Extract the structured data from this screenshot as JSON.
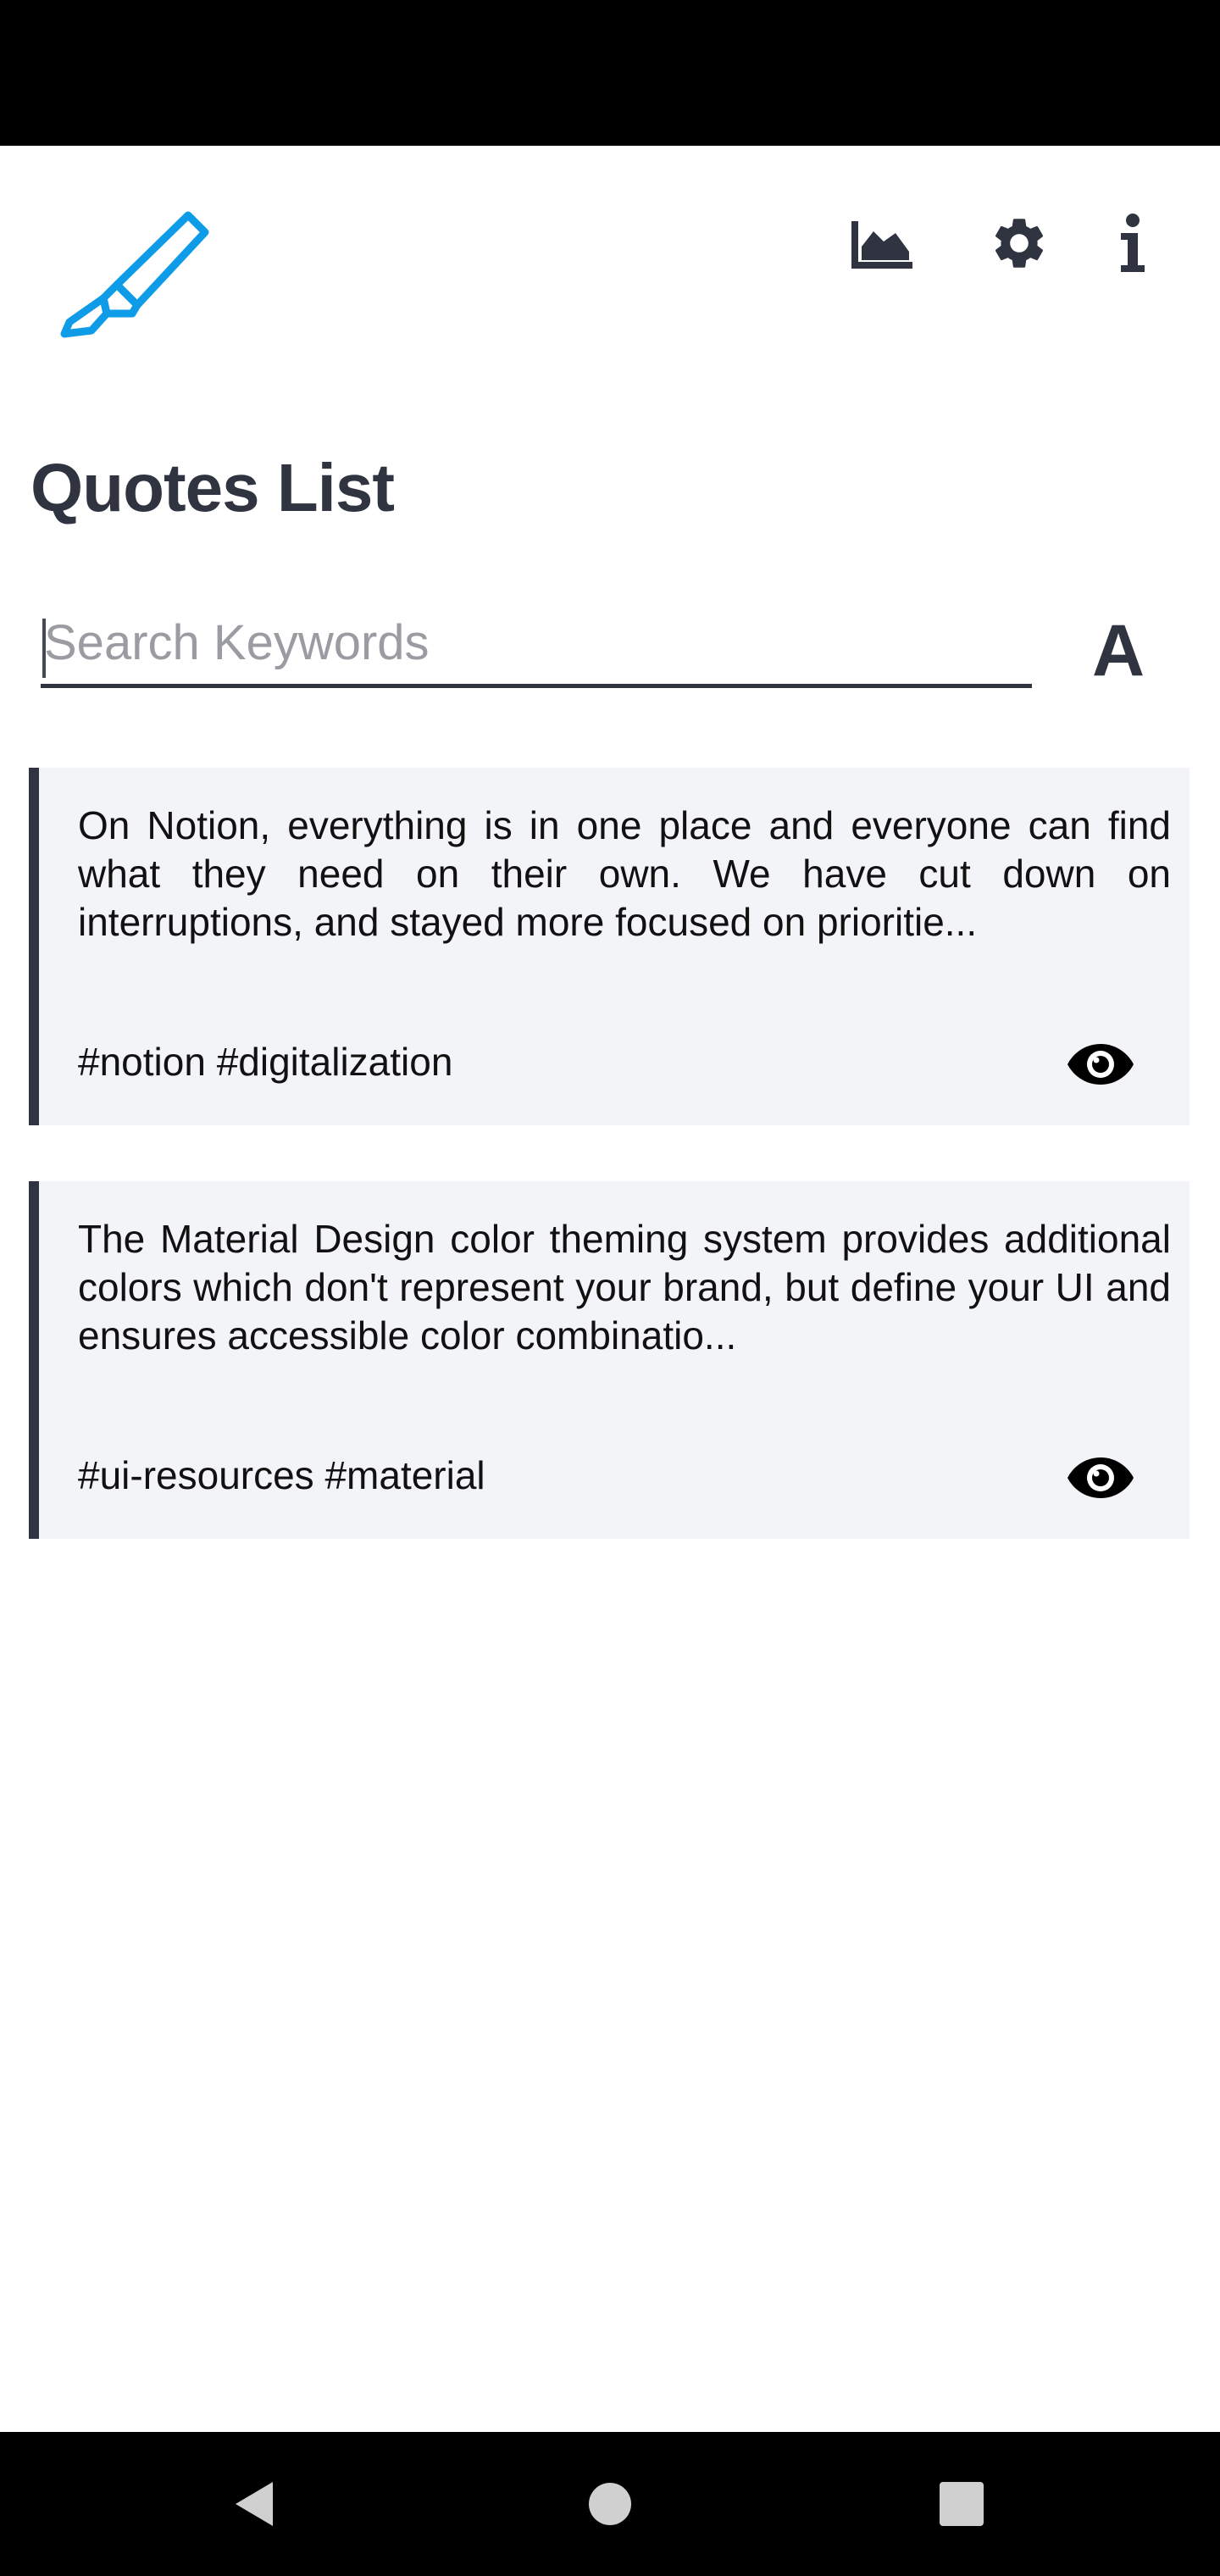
{
  "header": {
    "logo_icon": "highlighter-icon",
    "logo_color": "#0e9be8",
    "actions": [
      {
        "icon": "area-chart-icon"
      },
      {
        "icon": "gear-icon"
      },
      {
        "icon": "info-icon"
      }
    ]
  },
  "page": {
    "title": "Quotes List"
  },
  "search": {
    "placeholder": "Search Keywords",
    "value": "",
    "font_toggle_label": "A"
  },
  "quotes": [
    {
      "text": "On Notion, everything is in one place and everyone can find what they need on their own. We have cut down on interruptions, and stayed more focused on prioritie...",
      "tags": "#notion #digitalization",
      "action_icon": "eye-icon"
    },
    {
      "text": "The Material Design color theming system provides additional colors which don't represent your brand, but define your UI and ensures accessible color combinatio...",
      "tags": "#ui-resources #material",
      "action_icon": "eye-icon"
    }
  ],
  "colors": {
    "accent": "#0e9be8",
    "text_dark": "#2f3440",
    "card_bg": "#f3f4f7"
  },
  "navigation": {
    "buttons": [
      "back-icon",
      "home-icon",
      "recents-icon"
    ]
  }
}
